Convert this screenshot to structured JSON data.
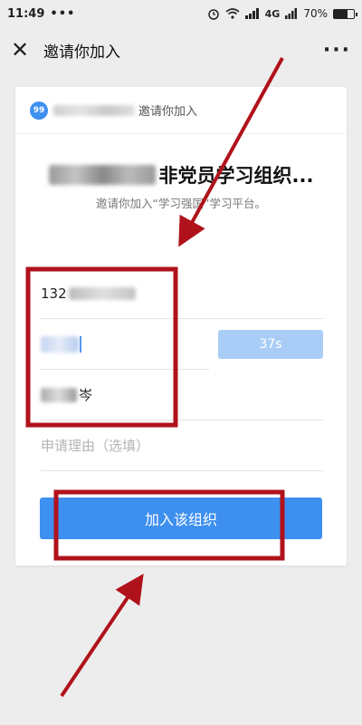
{
  "status_bar": {
    "time": "11:49",
    "dots": "•••",
    "network": "4G",
    "battery": "70%",
    "battery_level": 0.7
  },
  "title_bar": {
    "title": "邀请你加入",
    "close_icon": "close-icon",
    "more_icon": "more-icon"
  },
  "card": {
    "badge": "99",
    "head_text": "邀请你加入",
    "org_name": "非党员学习组织...",
    "subtitle": "邀请你加入“学习强国”学习平台。"
  },
  "form": {
    "phone_visible": "132",
    "code_button": "37s",
    "name_suffix": "岑",
    "reason_placeholder": "申请理由（选填）"
  },
  "join_button": "加入该组织",
  "colors": {
    "accent": "#3d8ff0",
    "annotation": "#b0121b"
  }
}
